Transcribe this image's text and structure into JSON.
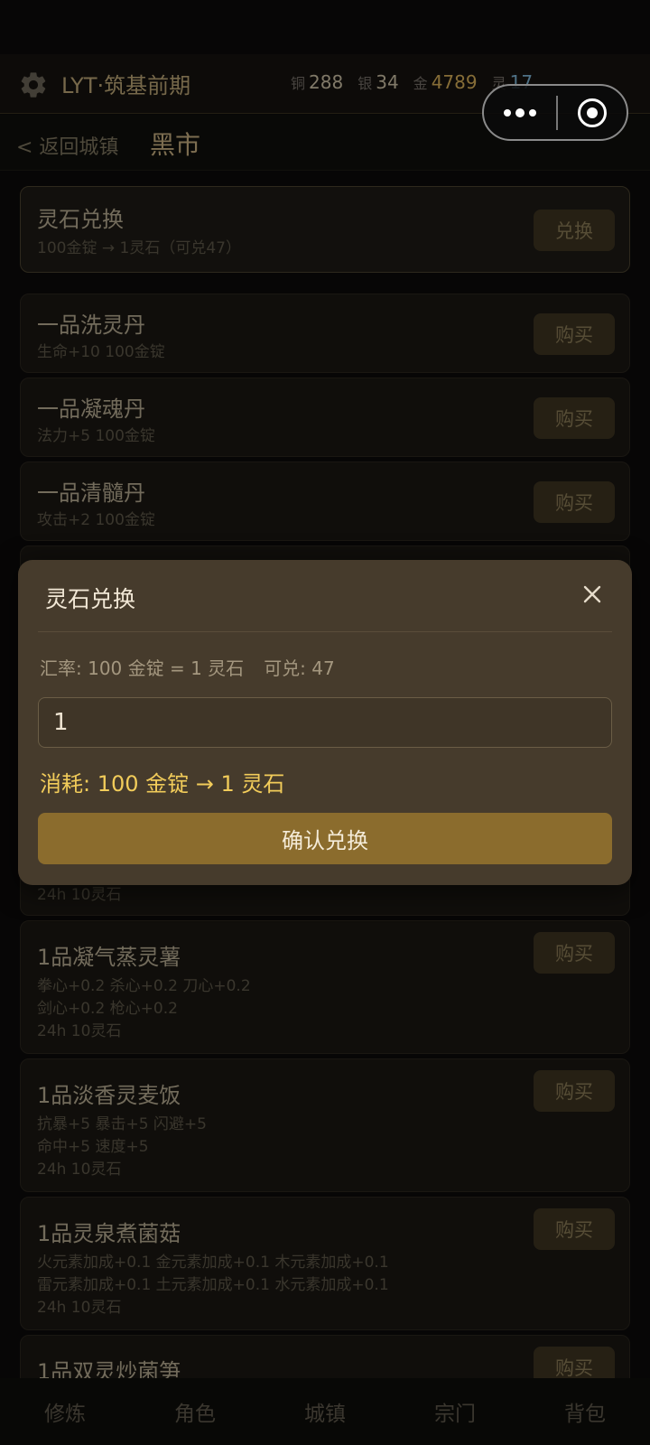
{
  "header": {
    "app_title": "LYT·筑基前期",
    "currencies": [
      {
        "label": "铜",
        "value": "288"
      },
      {
        "label": "银",
        "value": "34"
      },
      {
        "label": "金",
        "value": "4789"
      },
      {
        "label": "灵",
        "value": "17"
      }
    ]
  },
  "subheader": {
    "back_label": "< 返回城镇",
    "title": "黑市"
  },
  "exchange_card": {
    "name": "灵石兑换",
    "desc": "100金锭 → 1灵石（可兑47）",
    "button": "兑换"
  },
  "items": [
    {
      "name": "一品洗灵丹",
      "lines": [
        "生命+10  100金锭"
      ],
      "button": "购买"
    },
    {
      "name": "一品凝魂丹",
      "lines": [
        "法力+5  100金锭"
      ],
      "button": "购买"
    },
    {
      "name": "一品清髓丹",
      "lines": [
        "攻击+2  100金锭"
      ],
      "button": "购买"
    },
    {
      "name": "",
      "lines": [
        "24h  10灵石"
      ],
      "button": ""
    },
    {
      "name": "1品凝气蒸灵薯",
      "lines": [
        "拳心+0.2 杀心+0.2 刀心+0.2",
        "剑心+0.2 枪心+0.2",
        "24h  10灵石"
      ],
      "button": "购买"
    },
    {
      "name": "1品淡香灵麦饭",
      "lines": [
        "抗暴+5 暴击+5 闪避+5",
        "命中+5 速度+5",
        "24h  10灵石"
      ],
      "button": "购买"
    },
    {
      "name": "1品灵泉煮菌菇",
      "lines": [
        "火元素加成+0.1 金元素加成+0.1 木元素加成+0.1",
        "雷元素加成+0.1 土元素加成+0.1 水元素加成+0.1",
        "24h  10灵石"
      ],
      "button": "购买"
    },
    {
      "name": "1品双灵炒菌笋",
      "lines": [],
      "button": "购买"
    }
  ],
  "modal": {
    "title": "灵石兑换",
    "rate": "汇率: 100 金锭 = 1 灵石",
    "available": "可兑: 47",
    "input_value": "1",
    "cost": "消耗: 100 金锭 → 1 灵石",
    "confirm": "确认兑换"
  },
  "tabs": [
    "修炼",
    "角色",
    "城镇",
    "宗门",
    "背包"
  ]
}
